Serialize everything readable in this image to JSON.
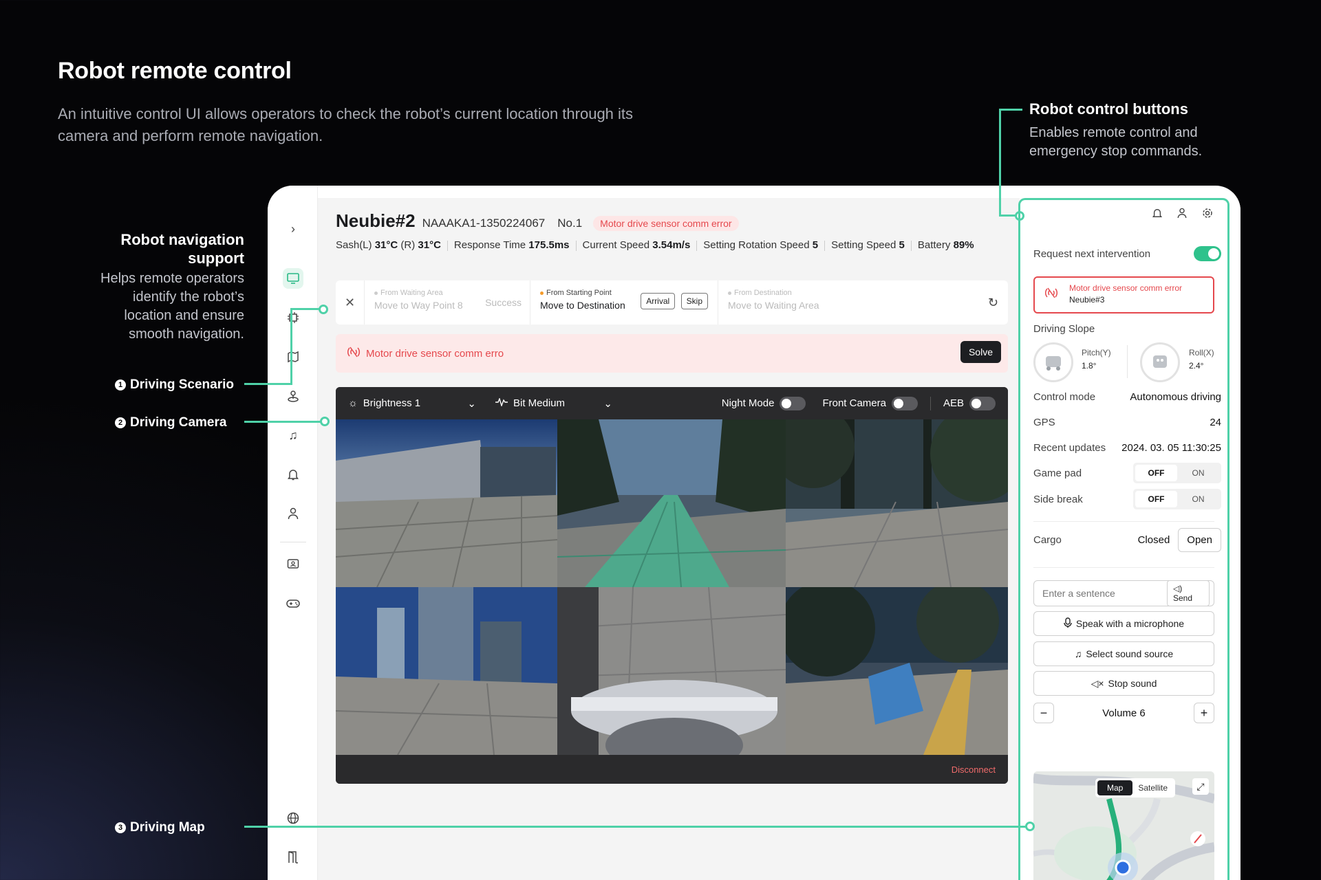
{
  "hero": {
    "title": "Robot remote control",
    "desc": "An intuitive control UI allows operators to check the robot’s current location through its camera and perform remote navigation."
  },
  "callouts": {
    "nav_title": "Robot navigation support",
    "nav_desc": "Helps remote operators identify the robot’s location and ensure smooth navigation.",
    "ctrl_title": "Robot control buttons",
    "ctrl_desc": "Enables remote control and emergency stop commands.",
    "scenario": {
      "num": "1",
      "label": "Driving Scenario"
    },
    "camera": {
      "num": "2",
      "label": "Driving Camera"
    },
    "map": {
      "num": "3",
      "label": "Driving Map"
    }
  },
  "robot": {
    "name": "Neubie#2",
    "serial": "NAAAKA1-1350224067",
    "no": "No.1",
    "error_badge": "Motor drive sensor comm error"
  },
  "stats": {
    "sash_label": "Sash(L)",
    "sash_l": "31°C",
    "sash_r_label": "(R)",
    "sash_r": "31°C",
    "response_label": "Response Time",
    "response": "175.5ms",
    "speed_label": "Current Speed",
    "speed": "3.54m/s",
    "rot_label": "Setting Rotation Speed",
    "rot": "5",
    "set_speed_label": "Setting Speed",
    "set_speed": "5",
    "battery_label": "Battery",
    "battery": "89%"
  },
  "scenario": {
    "s1_sub": "From Waiting Area",
    "s1_main": "Move to Way Point 8",
    "s1_status": "Success",
    "s2_sub": "From Starting Point",
    "s2_main": "Move to Destination",
    "btn_arrival": "Arrival",
    "btn_skip": "Skip",
    "s3_sub": "From Destination",
    "s3_main": "Move to Waiting Area"
  },
  "alert": {
    "text": "Motor drive sensor comm erro",
    "solve": "Solve"
  },
  "camera": {
    "brightness": "Brightness 1",
    "bitrate": "Bit Medium",
    "night_mode": "Night Mode",
    "front_camera": "Front Camera",
    "aeb": "AEB",
    "disconnect": "Disconnect"
  },
  "panel": {
    "request_label": "Request next intervention",
    "err_title": "Motor drive sensor comm error",
    "err_robot": "Neubie#3",
    "slope_label": "Driving Slope",
    "pitch_label": "Pitch(Y)",
    "pitch": "1.8°",
    "roll_label": "Roll(X)",
    "roll": "2.4°",
    "control_mode_label": "Control mode",
    "control_mode": "Autonomous driving",
    "gps_label": "GPS",
    "gps": "24",
    "updates_label": "Recent updates",
    "updates": "2024. 03. 05 11:30:25",
    "gamepad_label": "Game pad",
    "off": "OFF",
    "on": "ON",
    "sidebreak_label": "Side break",
    "cargo_label": "Cargo",
    "cargo_state": "Closed",
    "cargo_open": "Open",
    "sentence_placeholder": "Enter a sentence",
    "send": "Send",
    "speak": "Speak with a microphone",
    "select_sound": "Select sound source",
    "stop_sound": "Stop sound",
    "volume": "Volume 6",
    "map_tab": "Map",
    "satellite_tab": "Satellite"
  },
  "colors": {
    "accent": "#4fd1a8",
    "error": "#e5484d",
    "active_switch": "#2fc28c"
  }
}
